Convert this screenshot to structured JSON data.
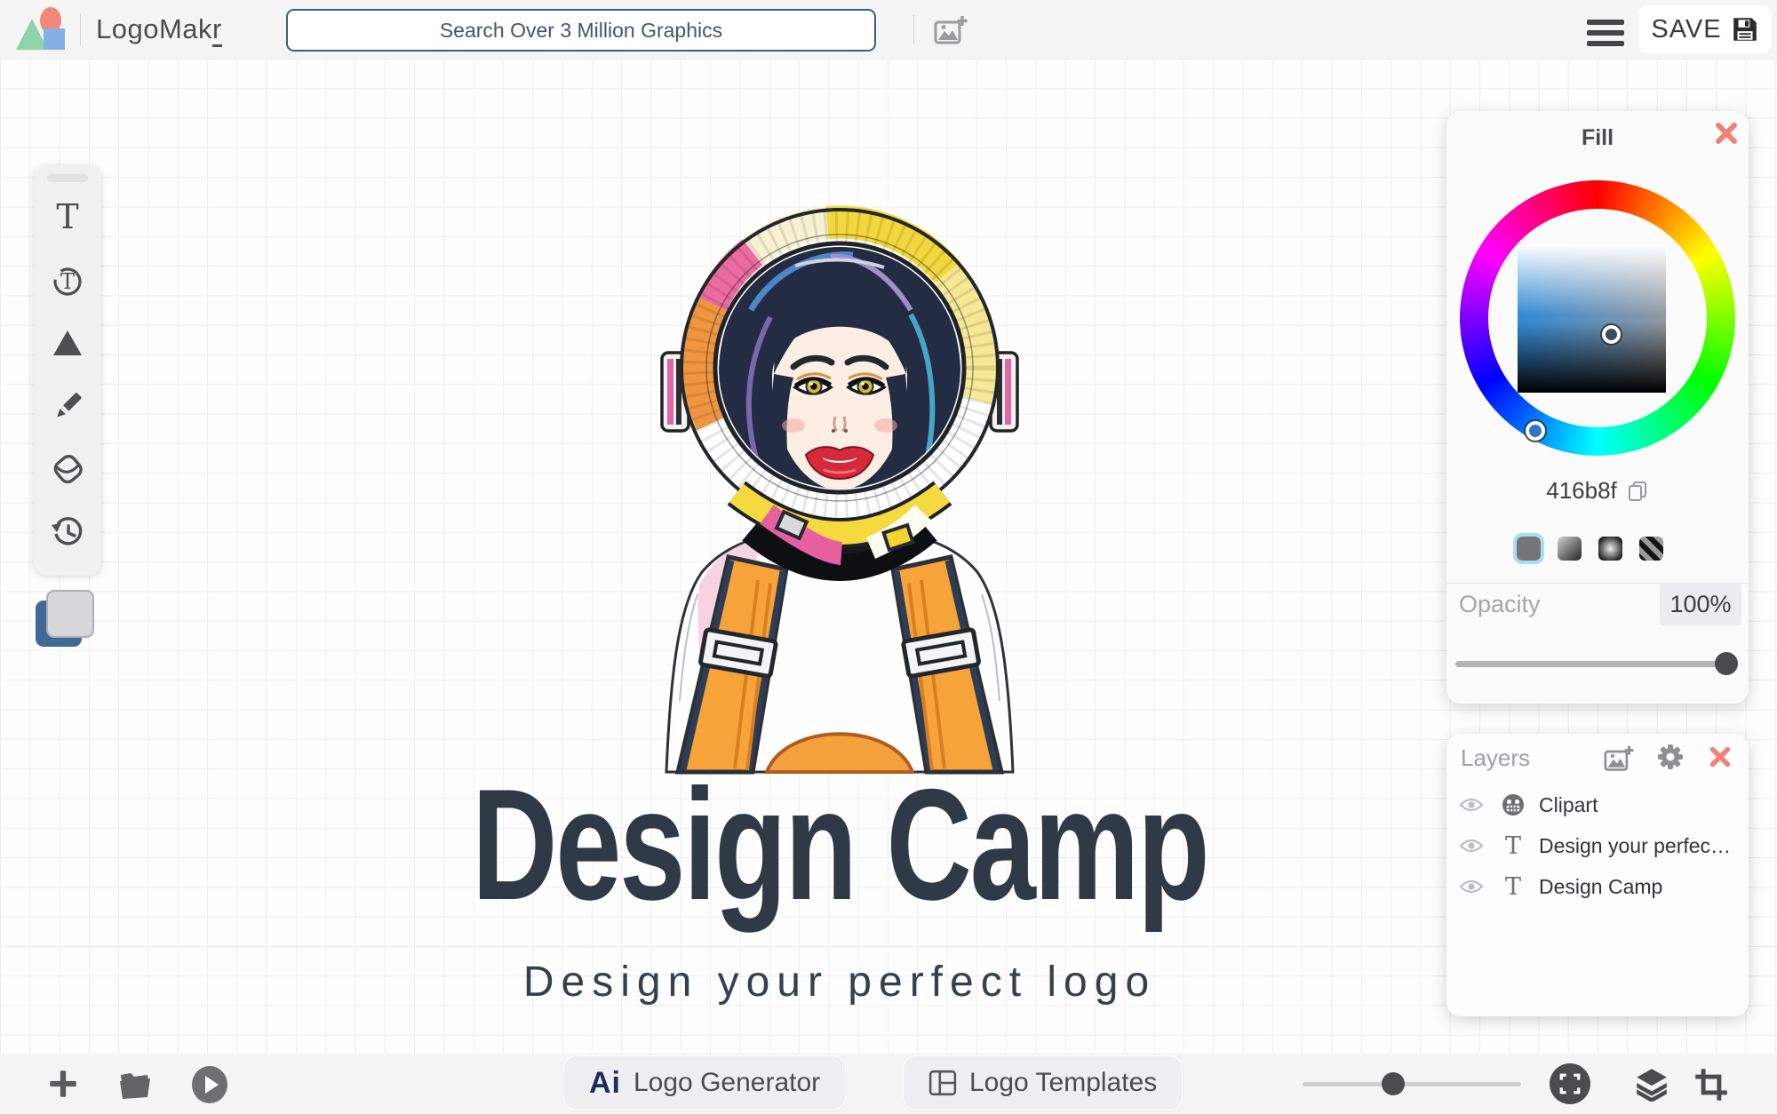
{
  "header": {
    "brand_prefix": "LogoMak",
    "brand_suffix": "r",
    "search_placeholder": "Search Over 3 Million Graphics",
    "save_label": "SAVE"
  },
  "tools": {
    "items": [
      "text-icon",
      "curved-text-icon",
      "shapes-icon",
      "draw-pencil-icon",
      "fill-bucket-icon",
      "history-icon"
    ]
  },
  "color_indicator": {
    "fill_color": "#3e6a95",
    "stroke_color": "#d7d7d9"
  },
  "fill_panel": {
    "title": "Fill",
    "hex_value": "416b8f",
    "selected_color": "#416b8f",
    "fill_styles": [
      "solid",
      "linear-gradient",
      "radial-gradient",
      "pattern"
    ],
    "selected_style": "solid",
    "opacity_label": "Opacity",
    "opacity_value": "100%"
  },
  "layers_panel": {
    "title": "Layers",
    "layers": [
      {
        "icon": "clipart-icon",
        "label": "Clipart"
      },
      {
        "icon": "text-icon",
        "label": "Design your perfec…"
      },
      {
        "icon": "text-icon",
        "label": "Design Camp"
      }
    ]
  },
  "canvas": {
    "logo_title": "Design Camp",
    "logo_tagline": "Design your perfect logo"
  },
  "footer": {
    "generator_icon": "Ai",
    "generator_label": "Logo Generator",
    "templates_label": "Logo Templates"
  }
}
